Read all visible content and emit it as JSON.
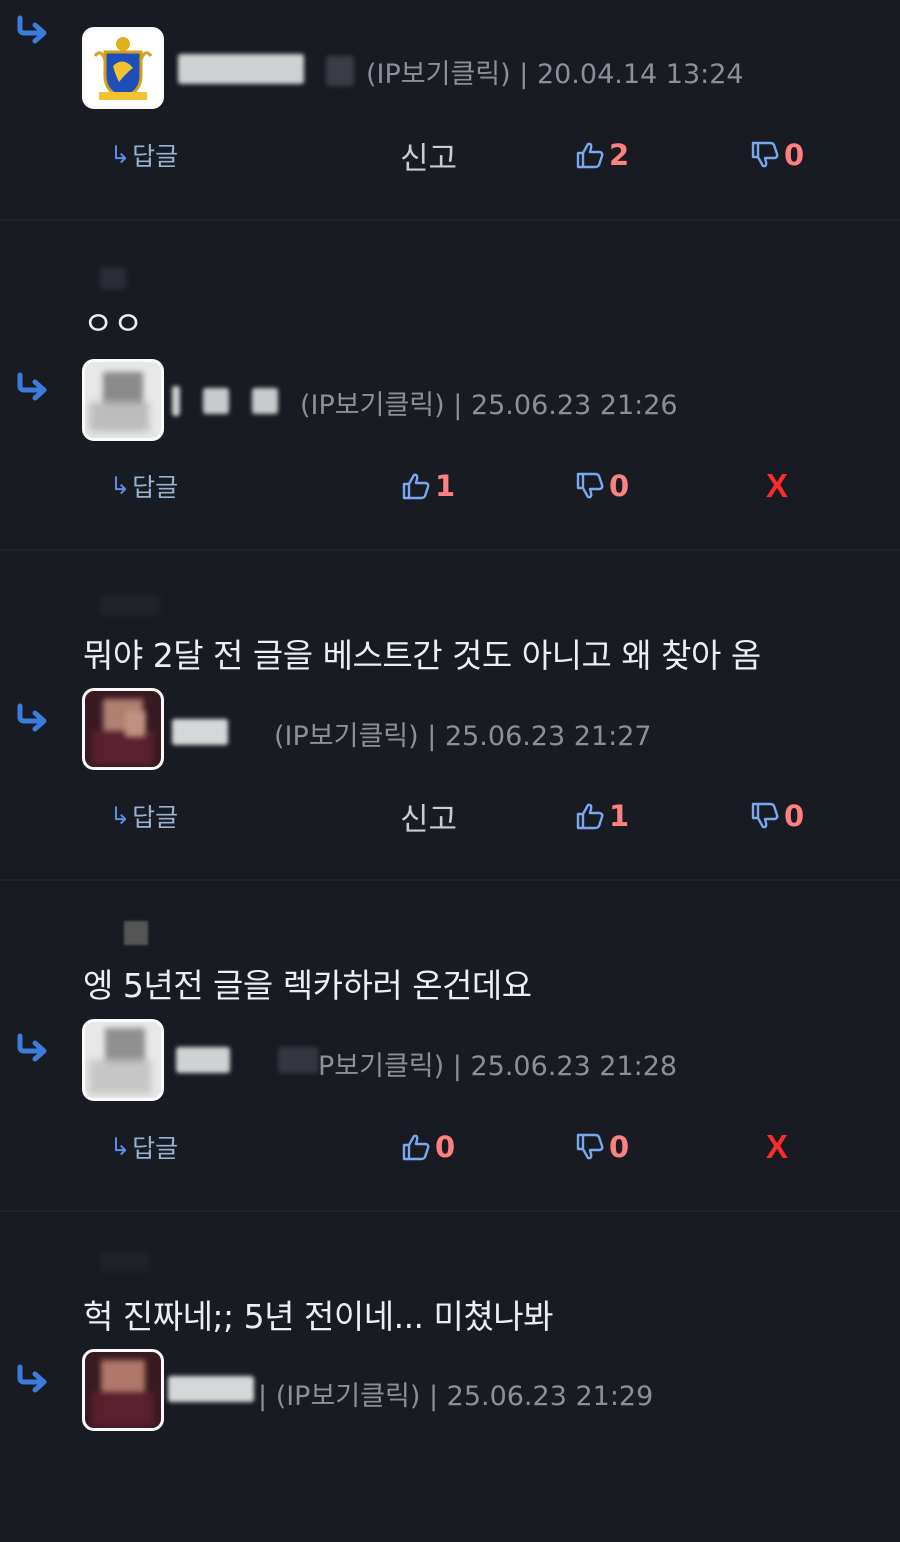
{
  "ui": {
    "reply_label": "답글",
    "report_label": "신고",
    "delete_label": "X"
  },
  "comments": [
    {
      "text": "",
      "ip_label": "(IP보기클릭)",
      "date": "20.04.14 13:24",
      "likes": "2",
      "dislikes": "0",
      "action": "report"
    },
    {
      "text": "ㅇㅇ",
      "ip_label": "(IP보기클릭)",
      "date": "25.06.23 21:26",
      "likes": "1",
      "dislikes": "0",
      "action": "delete"
    },
    {
      "text": "뭐야 2달 전 글을 베스트간 것도 아니고 왜 찾아 옴",
      "ip_label": "(IP보기클릭)",
      "date": "25.06.23 21:27",
      "likes": "1",
      "dislikes": "0",
      "action": "report"
    },
    {
      "text": "엥 5년전 글을 렉카하러 온건데요",
      "ip_label": "P보기클릭)",
      "date": "25.06.23 21:28",
      "likes": "0",
      "dislikes": "0",
      "action": "delete"
    },
    {
      "text": "헉 진짜네;; 5년 전이네... 미쳤나봐",
      "ip_label": "(IP보기클릭)",
      "date": "25.06.23 21:29",
      "likes": "",
      "dislikes": "",
      "action": ""
    }
  ],
  "colors": {
    "background": "#181b22",
    "reply_arrow": "#3b7ddd",
    "vote": "#ff8080",
    "delete": "#ff2a2a"
  }
}
